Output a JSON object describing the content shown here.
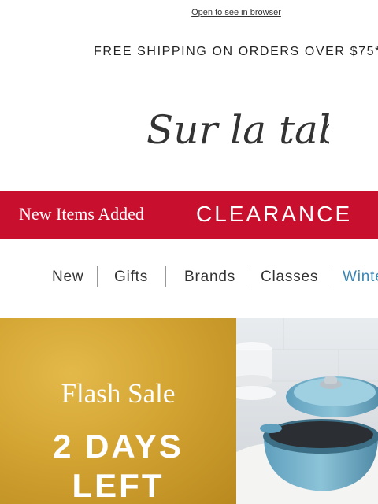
{
  "header": {
    "open_link": "Open to see in browser",
    "shipping": "FREE SHIPPING ON ORDERS OVER $75*"
  },
  "brand": {
    "logo_text": "Sur la table"
  },
  "promo_bar": {
    "new_items": "New Items Added",
    "clearance": "CLEARANCE",
    "color": "#c8102e"
  },
  "nav": {
    "items": [
      "New",
      "Gifts",
      "Brands",
      "Classes",
      "Winter"
    ]
  },
  "hero": {
    "flash": "Flash Sale",
    "days_line1": "2 DAYS",
    "days_line2": "LEFT",
    "gold": "#d3a432",
    "pot_color": "#7fb7cf"
  }
}
